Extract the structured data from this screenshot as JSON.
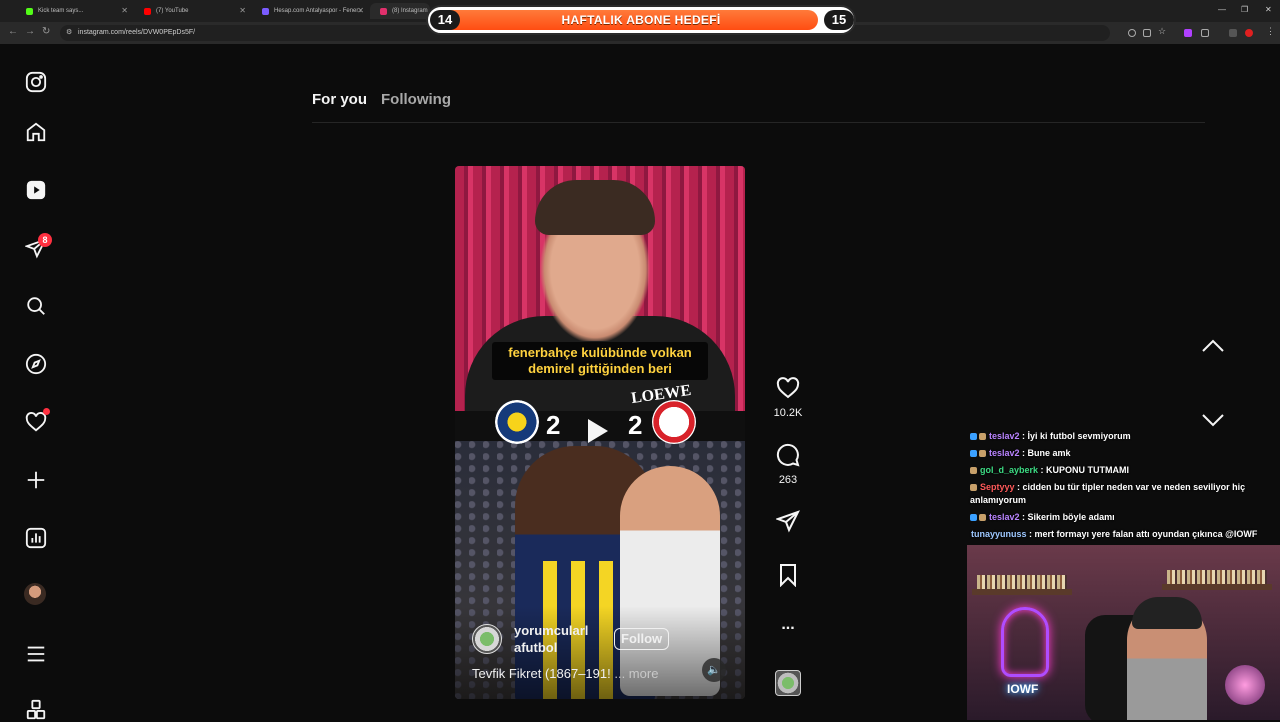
{
  "browser": {
    "tabs": [
      {
        "title": "Kick team says...",
        "color": "#53fc18"
      },
      {
        "title": "(7) YouTube",
        "color": "#ff0000"
      },
      {
        "title": "Hesap.com Antalyaspor - Fener...",
        "color": "#7a5cff"
      },
      {
        "title": "(8) Instagram",
        "color": "#e1306c"
      }
    ],
    "url": "instagram.com/reels/DVW0PEpDs5F/"
  },
  "overlay_banner": {
    "title": "HAFTALIK ABONE HEDEFİ",
    "current": "14",
    "goal": "15",
    "progress_fraction": 0.93
  },
  "sidebar": {
    "items": [
      {
        "name": "instagram-logo-icon"
      },
      {
        "name": "home-icon"
      },
      {
        "name": "reels-icon"
      },
      {
        "name": "messages-icon",
        "badge": "8"
      },
      {
        "name": "search-icon"
      },
      {
        "name": "explore-icon"
      },
      {
        "name": "notifications-icon"
      },
      {
        "name": "create-icon"
      },
      {
        "name": "dashboard-icon"
      },
      {
        "name": "profile-avatar"
      },
      {
        "name": "more-menu-icon"
      },
      {
        "name": "also-from-meta-icon"
      }
    ]
  },
  "feed_tabs": {
    "for_you": "For you",
    "following": "Following"
  },
  "reel": {
    "caption": "fenerbahçe kulübünde volkan demirel gittiğinden beri",
    "score_home": "2",
    "score_away": "2",
    "sponsor": "LOEWE",
    "username": "yorumcularl afutbol",
    "follow_label": "Follow",
    "description": "Tevfik Fikret (1867–191!",
    "more_label": "... more",
    "mute_icon": "🔈"
  },
  "actions": {
    "likes": "10.2K",
    "comments": "263",
    "more_label": "..."
  },
  "chat": [
    {
      "user": "teslav2",
      "color": "#b984ff",
      "text": ": İyi ki futbol sevmiyorum",
      "icon_color": "#3aa0ff"
    },
    {
      "user": "teslav2",
      "color": "#b984ff",
      "text": ": Bune amk",
      "icon_color": "#3aa0ff"
    },
    {
      "user": "gol_d_ayberk",
      "color": "#3ddc84",
      "text": ": KUPONU TUTMAMI",
      "icon_color": "#c8a06a"
    },
    {
      "user": "Septyyy",
      "color": "#ff5a5a",
      "text": ": cidden bu tür tipler neden var ve neden seviliyor hiç anlamıyorum",
      "icon_color": "#c8a06a"
    },
    {
      "user": "teslav2",
      "color": "#b984ff",
      "text": ": Sikerim böyle adamı",
      "icon_color": "#3aa0ff"
    },
    {
      "user": "tunayyunuss",
      "color": "#9ec8ff",
      "text": ": mert formayı yere falan attı oyundan çıkınca @IOWF",
      "icon_color": ""
    }
  ],
  "webcam": {
    "neon_label": "IOWF"
  }
}
